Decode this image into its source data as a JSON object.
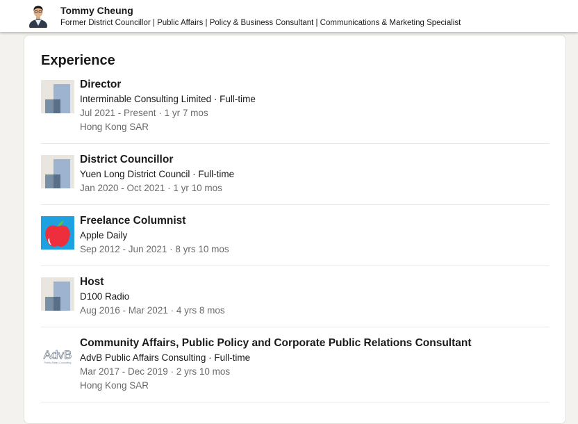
{
  "header": {
    "name": "Tommy Cheung",
    "headline": "Former District Councillor | Public Affairs | Policy & Business Consultant | Communications & Marketing Specialist"
  },
  "experience": {
    "title": "Experience",
    "items": [
      {
        "title": "Director",
        "company": "Interminable Consulting Limited · Full-time",
        "dates": "Jul 2021 - Present · 1 yr 7 mos",
        "location": "Hong Kong SAR",
        "logo": "generic-company-logo-icon"
      },
      {
        "title": "District Councillor",
        "company": "Yuen Long District Council · Full-time",
        "dates": "Jan 2020 - Oct 2021 · 1 yr 10 mos",
        "logo": "generic-company-logo-icon"
      },
      {
        "title": "Freelance Columnist",
        "company": "Apple Daily",
        "dates": "Sep 2012 - Jun 2021 · 8 yrs 10 mos",
        "logo": "apple-daily-logo-icon"
      },
      {
        "title": "Host",
        "company": "D100 Radio",
        "dates": "Aug 2016 - Mar 2021 · 4 yrs 8 mos",
        "logo": "generic-company-logo-icon"
      },
      {
        "title": "Community Affairs, Public Policy and Corporate Public Relations Consultant",
        "company": "AdvB Public Affairs Consulting · Full-time",
        "dates": "Mar 2017 - Dec 2019 · 2 yrs 10 mos",
        "location": "Hong Kong SAR",
        "logo": "advb-logo-icon",
        "logo_text": "AdvB",
        "logo_subtext": "Public Affairs Consulting"
      }
    ]
  },
  "colors": {
    "page_background": "#f4f2ee",
    "card_background": "#ffffff",
    "primary_text": "#000000e6",
    "secondary_text": "#00000099",
    "logo_placeholder_bg": "#e9e5df",
    "logo_placeholder_light": "#9db3cf",
    "logo_placeholder_dark": "#788fa5",
    "apple_daily_blue": "#1da1e0",
    "apple_daily_red": "#ee2e3d",
    "apple_daily_green": "#5cbf4a"
  }
}
